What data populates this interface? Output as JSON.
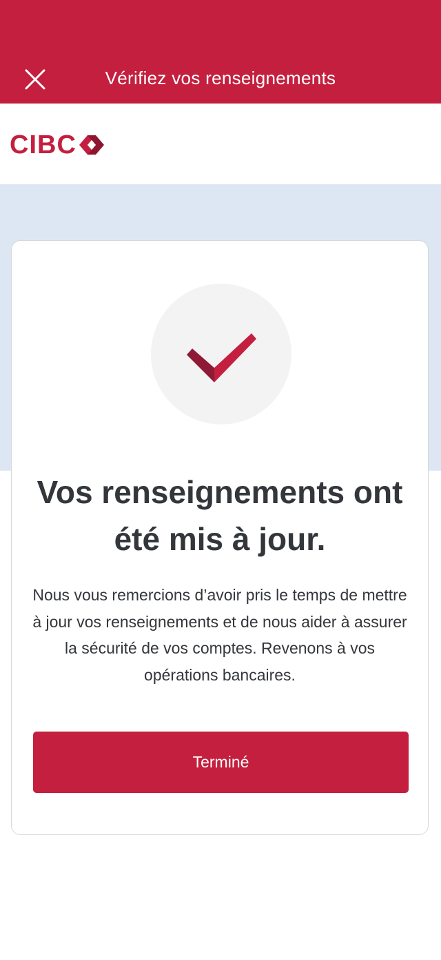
{
  "header": {
    "title": "Vérifiez vos renseignements",
    "close_icon": "close-icon",
    "background_color": "#c41f3e"
  },
  "logo": {
    "text": "CIBC",
    "color": "#c41f3e"
  },
  "confirmation": {
    "icon": "checkmark-icon",
    "heading": "Vos renseignements ont été mis à jour.",
    "message": "Nous vous remercions d’avoir pris le temps de mettre à jour vos renseignements et de nous aider à assurer la sécurité de vos comptes. Revenons à vos opérations bancaires.",
    "done_label": "Terminé"
  },
  "colors": {
    "accent": "#c41f3e",
    "band": "#dde7f4",
    "text": "#33363a"
  }
}
